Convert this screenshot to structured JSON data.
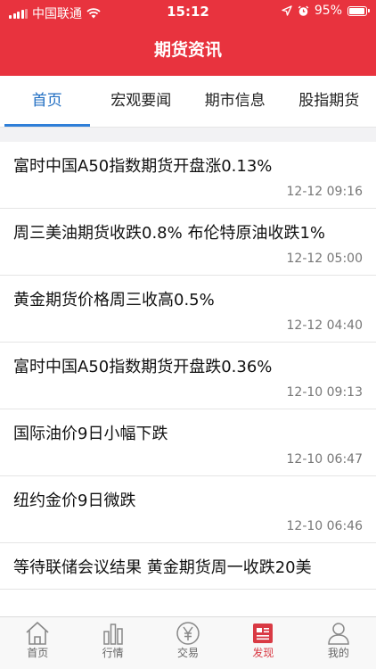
{
  "status_bar": {
    "carrier": "中国联通",
    "time": "15:12",
    "battery": "95%"
  },
  "header": {
    "title": "期货资讯"
  },
  "tabs": [
    {
      "label": "首页",
      "active": true
    },
    {
      "label": "宏观要闻",
      "active": false
    },
    {
      "label": "期市信息",
      "active": false
    },
    {
      "label": "股指期货",
      "active": false
    }
  ],
  "news": [
    {
      "title": "富时中国A50指数期货开盘涨0.13%",
      "time": "12-12 09:16"
    },
    {
      "title": "周三美油期货收跌0.8% 布伦特原油收跌1%",
      "time": "12-12 05:00"
    },
    {
      "title": "黄金期货价格周三收高0.5%",
      "time": "12-12 04:40"
    },
    {
      "title": "富时中国A50指数期货开盘跌0.36%",
      "time": "12-10 09:13"
    },
    {
      "title": "国际油价9日小幅下跌",
      "time": "12-10 06:47"
    },
    {
      "title": "纽约金价9日微跌",
      "time": "12-10 06:46"
    },
    {
      "title": "等待联储会议结果 黄金期货周一收跌20美",
      "time": ""
    }
  ],
  "bottom_nav": [
    {
      "label": "首页",
      "icon": "home-icon",
      "active": false
    },
    {
      "label": "行情",
      "icon": "chart-bars-icon",
      "active": false
    },
    {
      "label": "交易",
      "icon": "yen-coin-icon",
      "active": false
    },
    {
      "label": "发现",
      "icon": "news-doc-icon",
      "active": true
    },
    {
      "label": "我的",
      "icon": "user-icon",
      "active": false
    }
  ],
  "colors": {
    "brand_red": "#e8333e",
    "tab_active_blue": "#1f6dc2",
    "bottom_active": "#d93a44"
  }
}
